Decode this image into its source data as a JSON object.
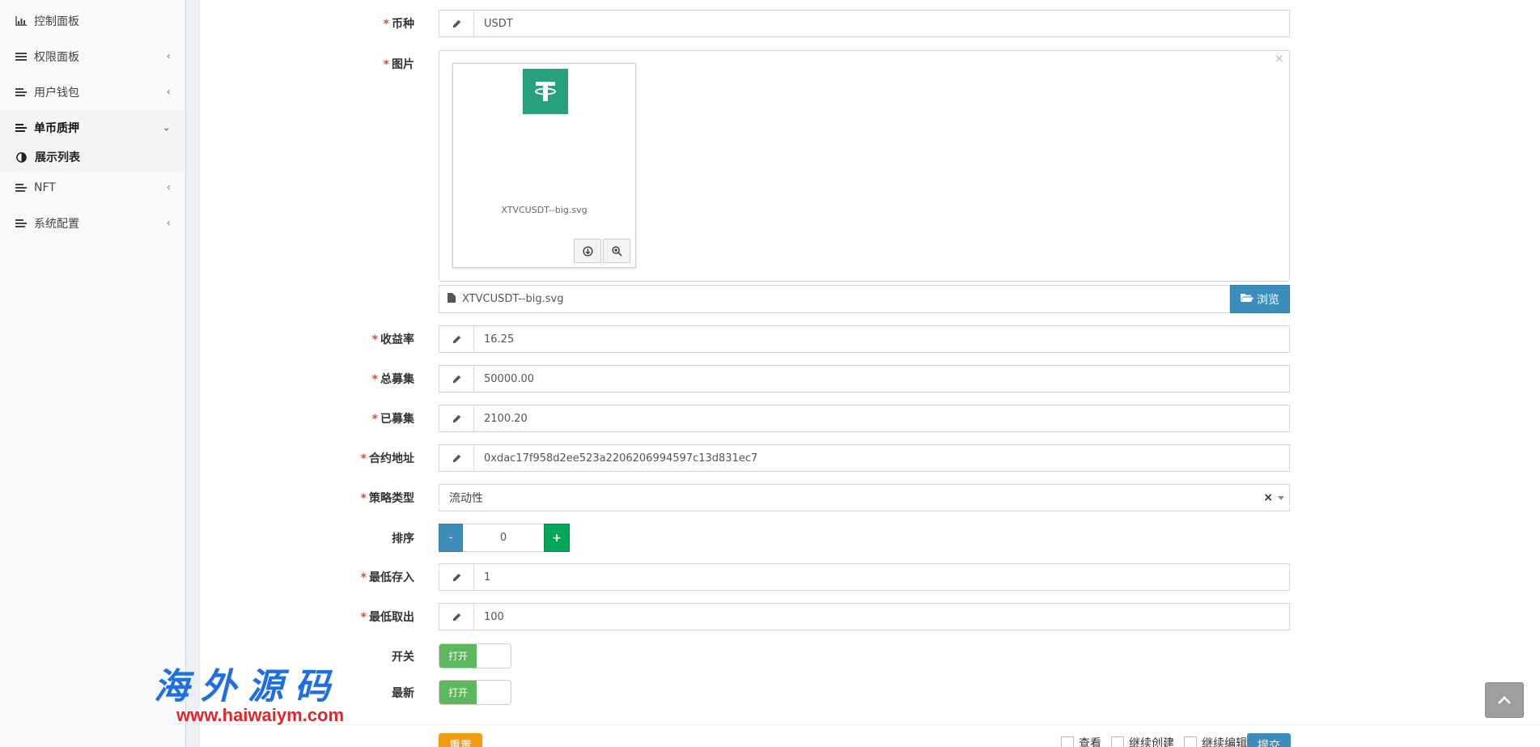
{
  "sidebar": {
    "items": [
      {
        "label": "控制面板",
        "icon": "bar-chart-icon",
        "chevron": ""
      },
      {
        "label": "权限面板",
        "icon": "list-icon",
        "chevron": "‹"
      },
      {
        "label": "用户钱包",
        "icon": "list-icon",
        "chevron": "‹"
      },
      {
        "label": "单币质押",
        "icon": "list-icon",
        "chevron": "⌄"
      },
      {
        "label": "NFT",
        "icon": "list-icon",
        "chevron": "‹"
      },
      {
        "label": "系统配置",
        "icon": "list-icon",
        "chevron": "‹"
      }
    ],
    "sub_item": {
      "label": "展示列表",
      "icon": "half-circle-icon"
    }
  },
  "form": {
    "coin": {
      "label": "币种",
      "value": "USDT"
    },
    "image": {
      "label": "图片",
      "file_name": "XTVCUSDT--big.svg",
      "close": "×",
      "browse_label": "浏览"
    },
    "yield_rate": {
      "label": "收益率",
      "value": "16.25"
    },
    "total_raise": {
      "label": "总募集",
      "value": "50000.00"
    },
    "raised": {
      "label": "已募集",
      "value": "2100.20"
    },
    "contract": {
      "label": "合约地址",
      "value": "0xdac17f958d2ee523a2206206994597c13d831ec7"
    },
    "strategy": {
      "label": "策略类型",
      "value": "流动性",
      "clear": "×"
    },
    "sort": {
      "label": "排序",
      "value": "0",
      "minus": "-",
      "plus": "+"
    },
    "min_deposit": {
      "label": "最低存入",
      "value": "1"
    },
    "min_withdraw": {
      "label": "最低取出",
      "value": "100"
    },
    "switch": {
      "label": "开关",
      "on_label": "打开"
    },
    "latest": {
      "label": "最新",
      "on_label": "打开"
    }
  },
  "footer": {
    "reset_label": "重置",
    "submit_label": "提交",
    "checks": [
      "查看",
      "继续创建",
      "继续编辑"
    ]
  },
  "watermark": {
    "cn": "海外源码",
    "url": "www.haiwaiym.com"
  },
  "colors": {
    "primary": "#3c8dbc",
    "success": "#00a65a",
    "warning": "#f39c12",
    "required": "#dd4b39",
    "tether": "#26a17b"
  }
}
